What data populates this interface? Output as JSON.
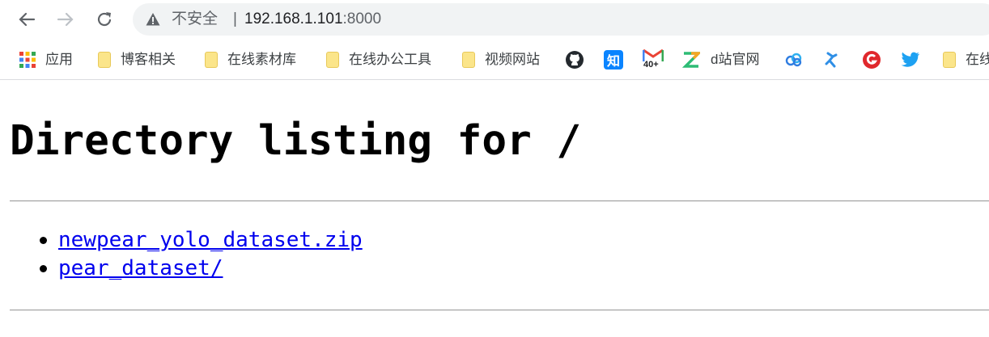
{
  "browser": {
    "address": {
      "security_label": "不安全",
      "separator": "|",
      "url_host": "192.168.1.101",
      "url_port": ":8000"
    },
    "bookmarks": [
      {
        "label": "应用",
        "icon": "apps-grid-icon"
      },
      {
        "label": "博客相关",
        "icon": "folder-icon"
      },
      {
        "label": "在线素材库",
        "icon": "folder-icon"
      },
      {
        "label": "在线办公工具",
        "icon": "folder-icon"
      },
      {
        "label": "视频网站",
        "icon": "folder-icon"
      },
      {
        "label": "",
        "icon": "github-icon"
      },
      {
        "label": "",
        "icon": "zhihu-icon",
        "glyph": "知"
      },
      {
        "label": "",
        "icon": "gmail-icon",
        "glyph": "40+"
      },
      {
        "label": "d站官网",
        "icon": "z-logo-icon"
      },
      {
        "label": "",
        "icon": "cloud-icon"
      },
      {
        "label": "",
        "icon": "runner-icon"
      },
      {
        "label": "",
        "icon": "red-g-icon"
      },
      {
        "label": "",
        "icon": "twitter-icon"
      },
      {
        "label": "在线",
        "icon": "folder-icon"
      }
    ]
  },
  "page": {
    "title": "Directory listing for /",
    "files": [
      {
        "name": "newpear_yolo_dataset.zip"
      },
      {
        "name": "pear_dataset/"
      }
    ]
  }
}
